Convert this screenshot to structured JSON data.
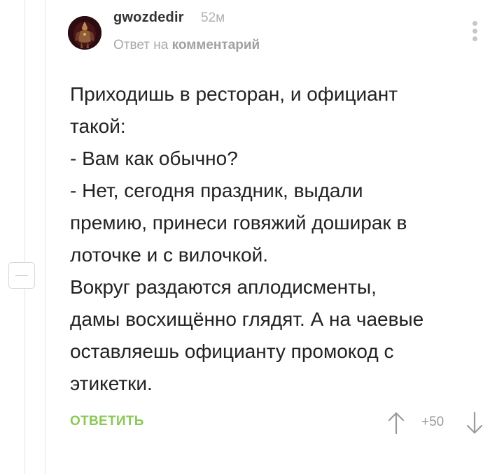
{
  "comment": {
    "author": "gwozdedir",
    "time": "52м",
    "reply_prefix": "Ответ на",
    "reply_link": "комментарий",
    "text": "Приходишь в ресторан, и официант\nтакой:\n - Вам как обычно?\n- Нет, сегодня праздник, выдали\nпремию, принеси говяжий доширак в\nлоточке и с вилочкой.\nВокруг раздаются аплодисменты,\nдамы восхищённо глядят. А на чаевые\nоставляешь официанту промокод с\nэтикетки."
  },
  "actions": {
    "reply": "ОТВЕТИТЬ",
    "rating": "+50"
  },
  "icons": {
    "collapse": "minus-icon",
    "more": "vertical-dots-icon",
    "upvote": "arrow-up-icon",
    "downvote": "arrow-down-icon"
  },
  "colors": {
    "accent_green": "#8ac858",
    "muted_text": "#a8a8a8",
    "thread_line": "#e4e4e4"
  }
}
